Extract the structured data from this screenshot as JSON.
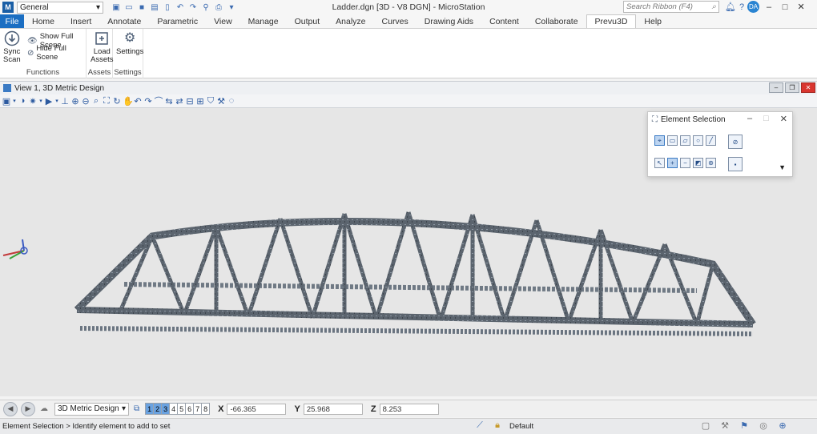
{
  "titlebar": {
    "workspace": "General",
    "window_title": "Ladder.dgn [3D - V8 DGN] - MicroStation",
    "search_placeholder": "Search Ribbon (F4)",
    "user_initials": "DA"
  },
  "tabs": [
    "File",
    "Home",
    "Insert",
    "Annotate",
    "Parametric",
    "View",
    "Manage",
    "Output",
    "Analyze",
    "Curves",
    "Drawing Aids",
    "Content",
    "Collaborate",
    "Prevu3D",
    "Help"
  ],
  "active_tab": "Prevu3D",
  "ribbon": {
    "functions": {
      "label": "Functions",
      "sync_scan": "Sync\nScan",
      "show_full_scene": "Show Full Scene",
      "hide_full_scene": "Hide Full Scene"
    },
    "assets": {
      "label": "Assets",
      "load_assets": "Load\nAssets"
    },
    "settings": {
      "label": "Settings",
      "settings_button": "Settings"
    }
  },
  "view": {
    "title": "View 1, 3D Metric Design"
  },
  "element_selection": {
    "title": "Element Selection"
  },
  "bottom": {
    "view_select": "3D Metric Design",
    "view_numbers": [
      "1",
      "2",
      "3",
      "4",
      "5",
      "6",
      "7",
      "8"
    ],
    "x_label": "X",
    "x_value": "-66.365",
    "y_label": "Y",
    "y_value": "25.968",
    "z_label": "Z",
    "z_value": "8.253"
  },
  "status": {
    "message": "Element Selection > Identify element to add to set",
    "level": "Default"
  },
  "colors": {
    "file_tab": "#1b6ec2",
    "canvas": "#e6e6e6",
    "bridge": "#5d6670"
  }
}
